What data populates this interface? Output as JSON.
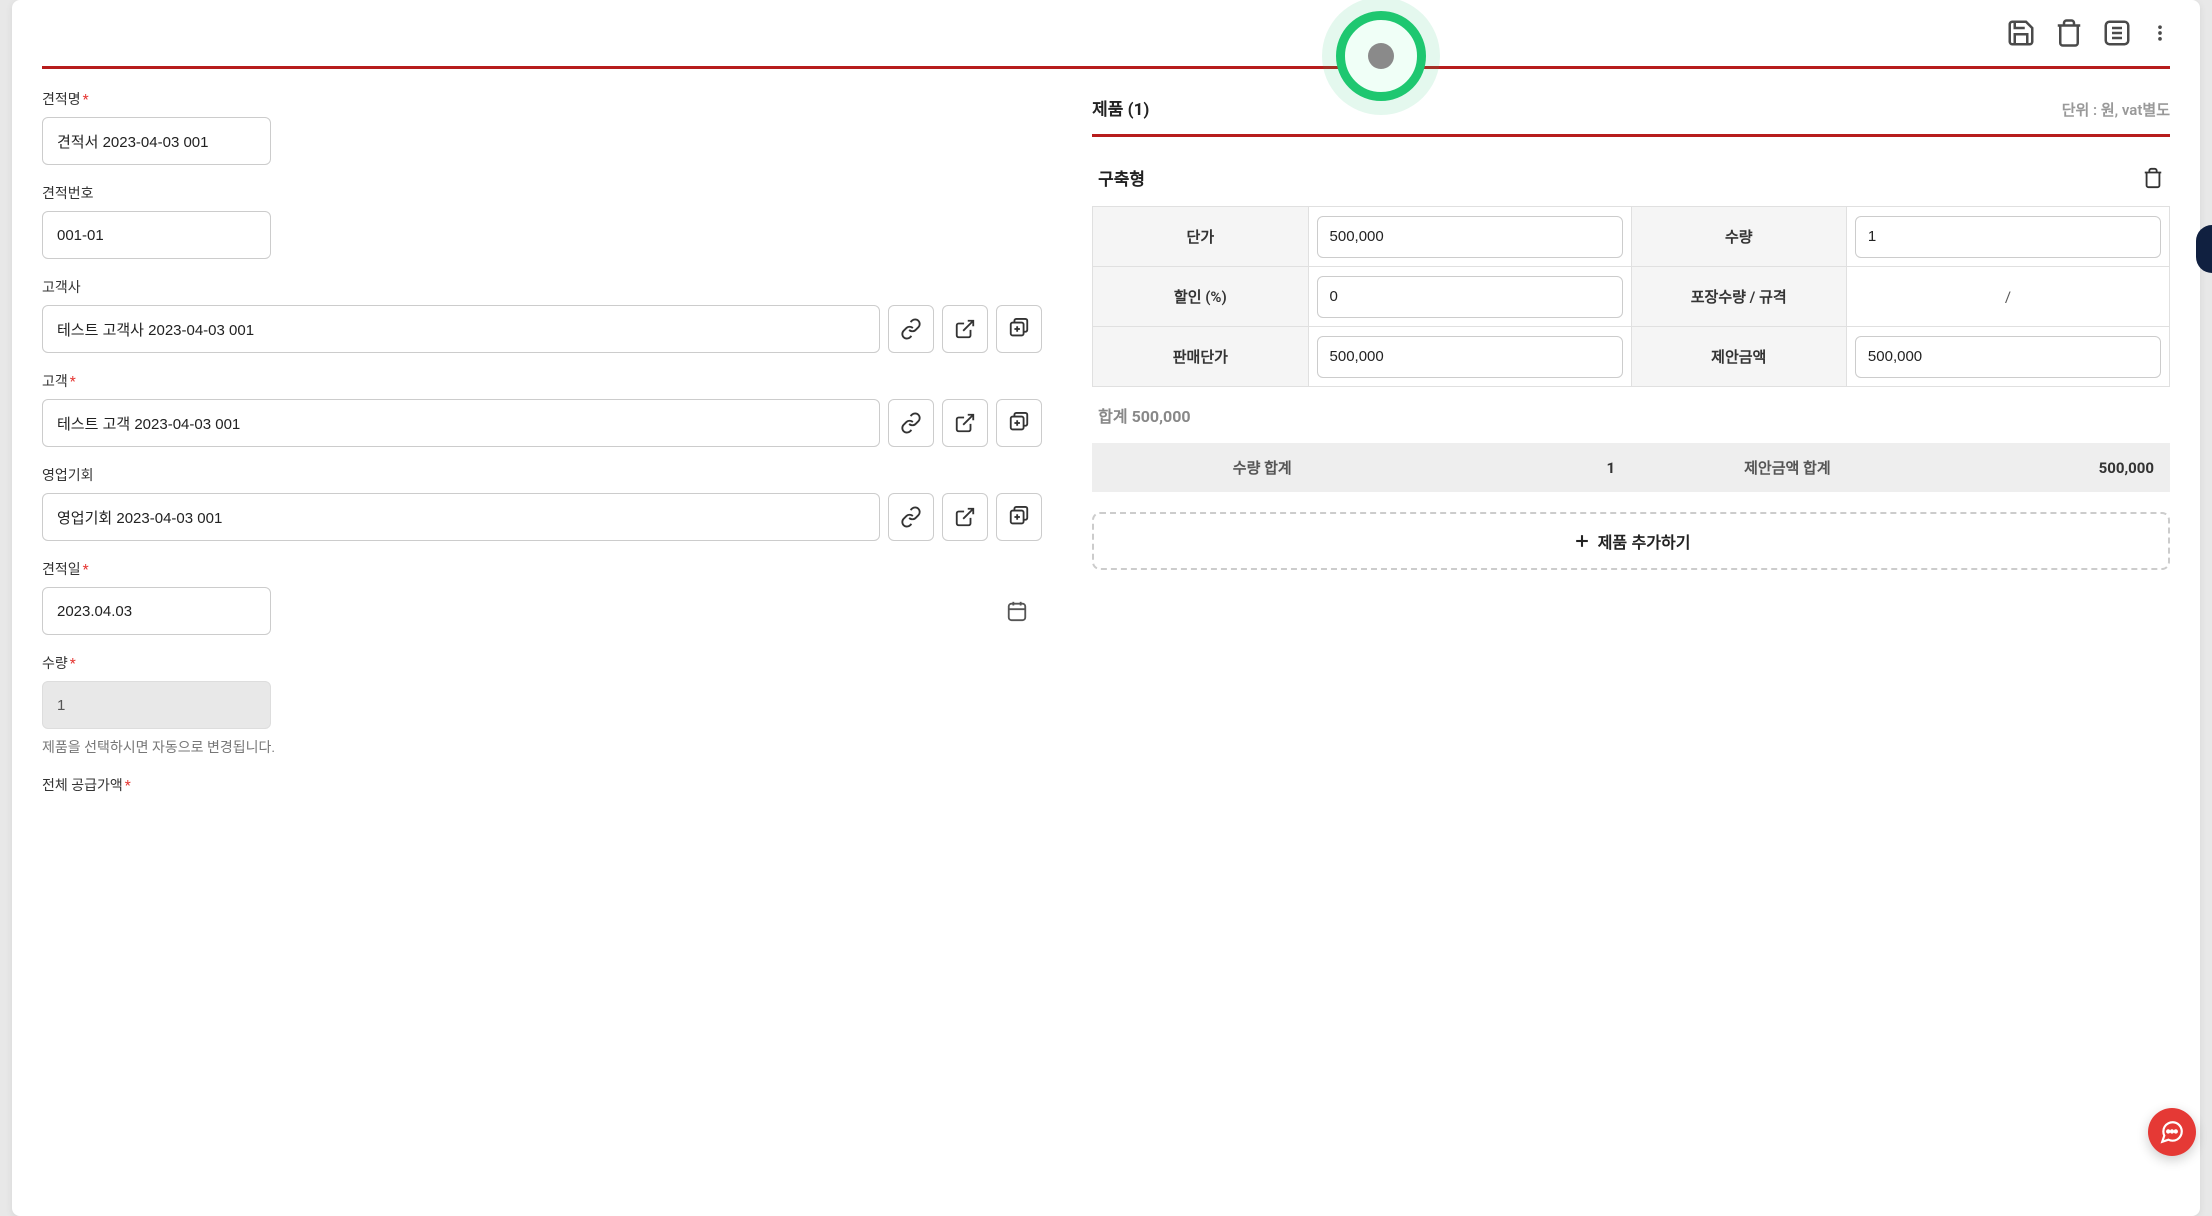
{
  "form": {
    "quote_name": {
      "label": "견적명",
      "value": "견적서 2023-04-03 001",
      "required": true
    },
    "quote_number": {
      "label": "견적번호",
      "value": "001-01",
      "required": false
    },
    "client_company": {
      "label": "고객사",
      "value": "테스트 고객사 2023-04-03 001",
      "required": false
    },
    "client_contact": {
      "label": "고객",
      "value": "테스트 고객 2023-04-03 001",
      "required": true
    },
    "opportunity": {
      "label": "영업기회",
      "value": "영업기회 2023-04-03 001",
      "required": false
    },
    "quote_date": {
      "label": "견적일",
      "value": "2023.04.03",
      "required": true
    },
    "quantity": {
      "label": "수량",
      "value": "1",
      "required": true,
      "hint": "제품을 선택하시면 자동으로 변경됩니다."
    },
    "total_supply": {
      "label": "전체 공급가액",
      "required": true
    }
  },
  "products": {
    "header_title": "제품 (1)",
    "header_unit": "단위 : 원, vat별도",
    "item_name": "구축형",
    "fields": {
      "unit_price": {
        "label": "단가",
        "value": "500,000"
      },
      "qty": {
        "label": "수량",
        "value": "1"
      },
      "discount": {
        "label": "할인 (%)",
        "value": "0"
      },
      "package_spec": {
        "label": "포장수량 / 규격",
        "value": "/"
      },
      "sale_price": {
        "label": "판매단가",
        "value": "500,000"
      },
      "proposal_amount": {
        "label": "제안금액",
        "value": "500,000"
      }
    },
    "subtotal": "합계 500,000",
    "summary": {
      "qty_total_label": "수량 합계",
      "qty_total_value": "1",
      "amount_total_label": "제안금액 합계",
      "amount_total_value": "500,000"
    },
    "add_button": "제품 추가하기"
  }
}
